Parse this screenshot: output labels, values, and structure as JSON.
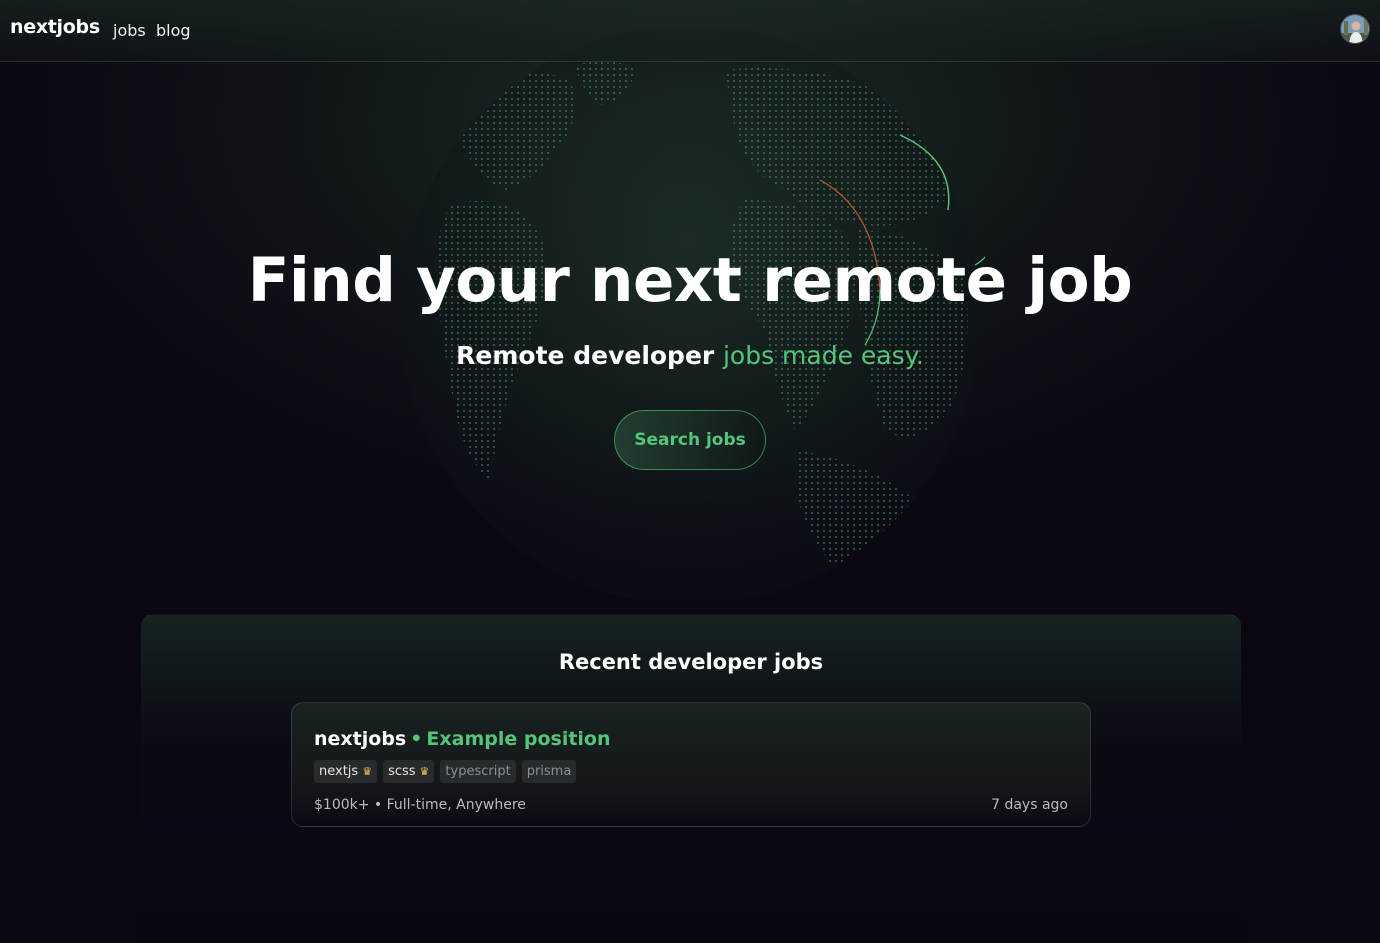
{
  "nav": {
    "logo": "nextjobs",
    "links": [
      {
        "label": "jobs"
      },
      {
        "label": "blog"
      }
    ],
    "avatar_icon": "user-avatar"
  },
  "hero": {
    "title": "Find your next remote job",
    "subtitle_white": "Remote developer ",
    "subtitle_green": "jobs made easy.",
    "cta_label": "Search jobs"
  },
  "recent": {
    "title": "Recent developer jobs",
    "jobs": [
      {
        "company": "nextjobs",
        "separator": "•",
        "position": "Example position",
        "tags": [
          {
            "label": "nextjs",
            "featured": true,
            "icon": "crown-icon"
          },
          {
            "label": "scss",
            "featured": true,
            "icon": "crown-icon"
          },
          {
            "label": "typescript",
            "featured": false
          },
          {
            "label": "prisma",
            "featured": false
          }
        ],
        "meta": "$100k+ • Full-time, Anywhere",
        "age": "7 days ago"
      }
    ]
  },
  "colors": {
    "accent": "#55c57a",
    "background": "#0a0711",
    "arc_red": "#c2553a"
  }
}
